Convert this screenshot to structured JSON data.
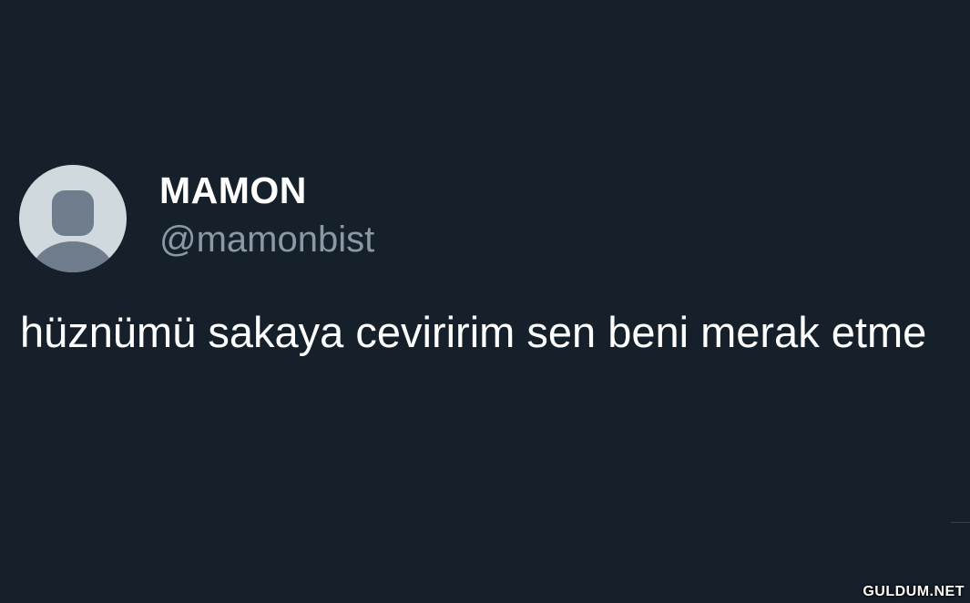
{
  "tweet": {
    "avatar_icon": "default-profile-icon",
    "display_name": "MAMON",
    "handle": "@mamonbist",
    "text": "hüznümü sakaya ceviririm sen beni merak etme"
  },
  "colors": {
    "background": "#16202a",
    "primary_text": "#ffffff",
    "secondary_text": "#8b98a5",
    "avatar_bg": "#cfd9de",
    "avatar_figure": "#6e7c8b"
  },
  "watermark": "GULDUM.NET"
}
